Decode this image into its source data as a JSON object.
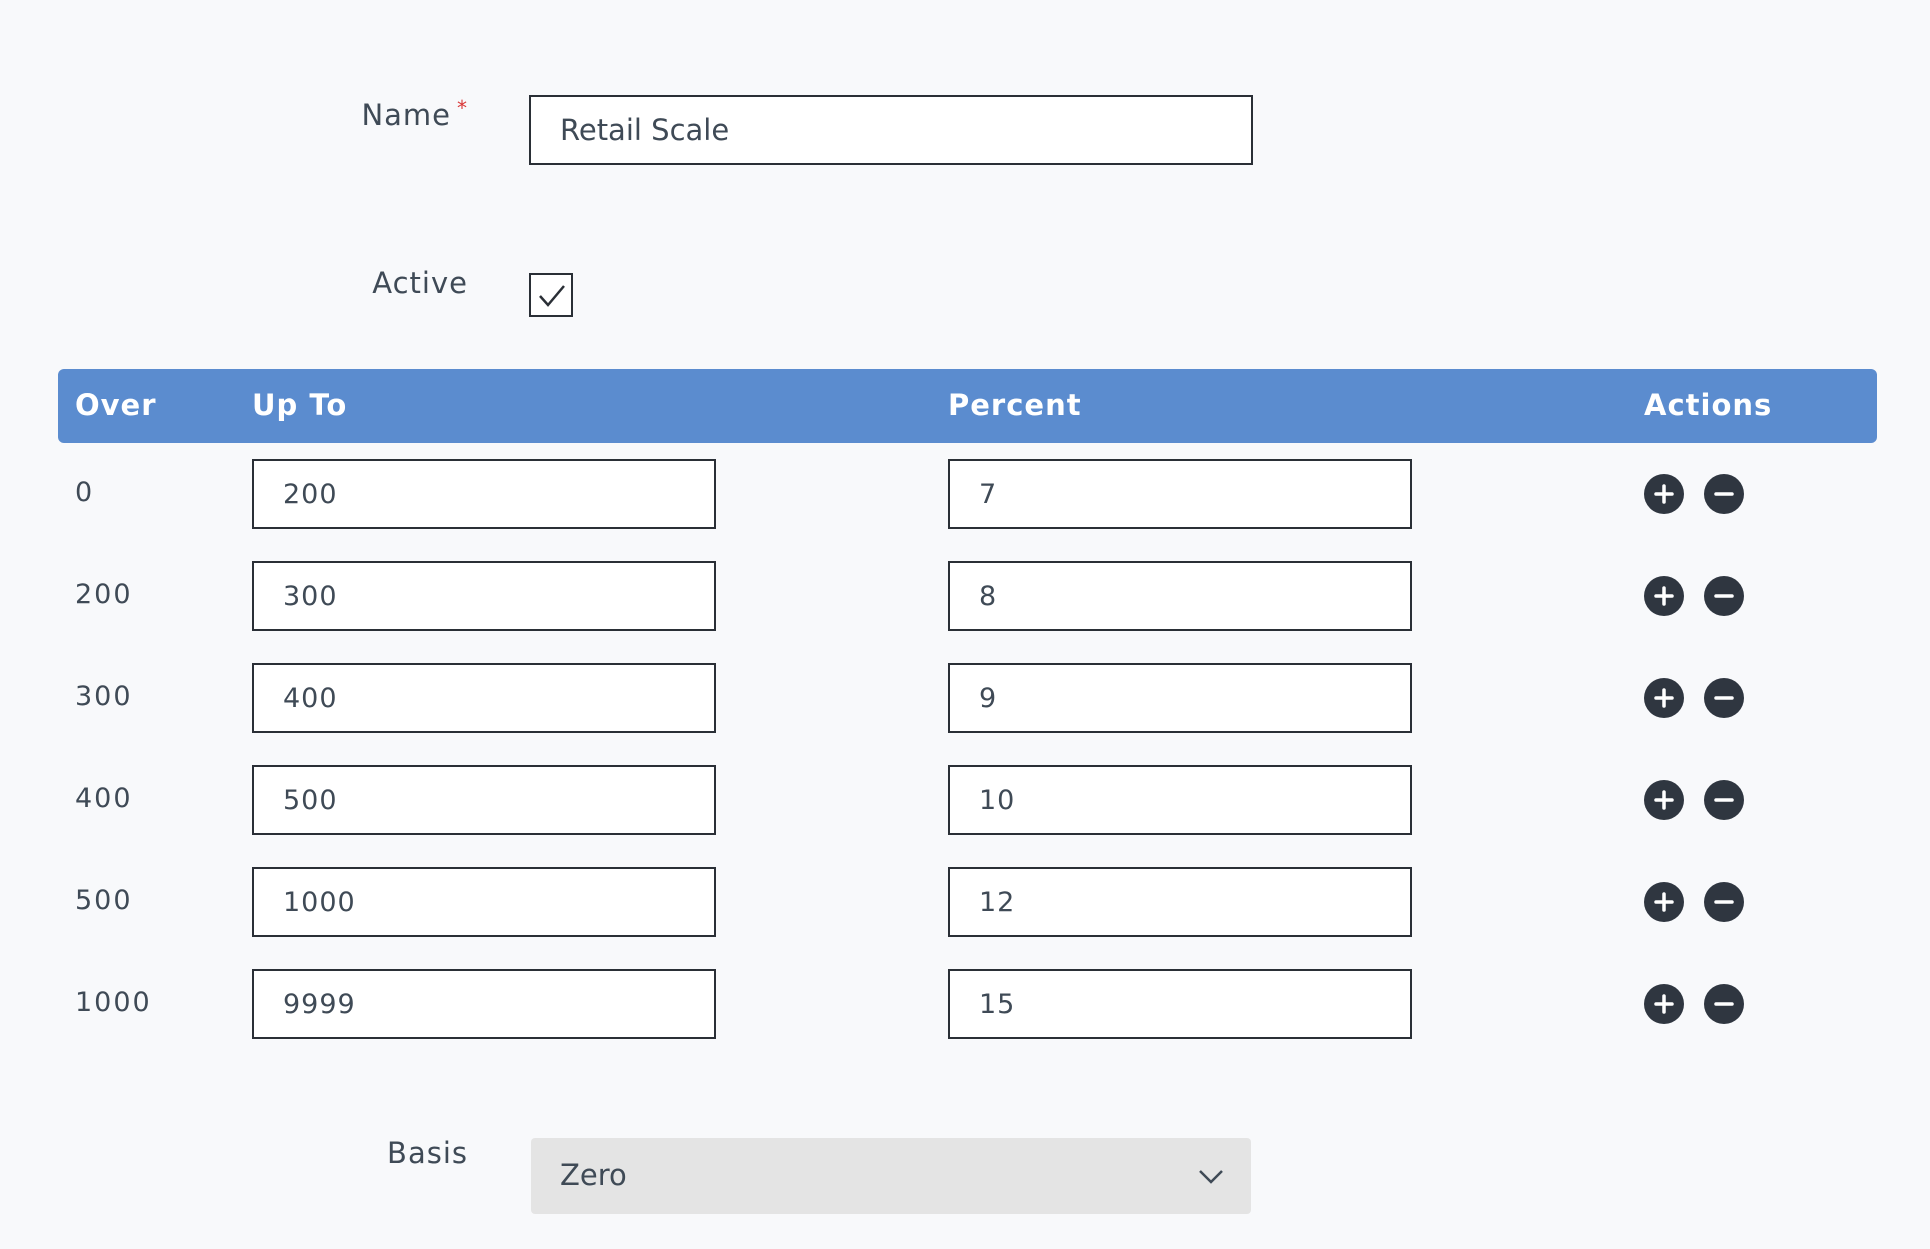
{
  "form": {
    "name_label": "Name",
    "required_marker": "*",
    "name_value": "Retail Scale",
    "active_label": "Active",
    "active_checked": true,
    "basis_label": "Basis",
    "basis_value": "Zero"
  },
  "table": {
    "headers": {
      "over": "Over",
      "up_to": "Up To",
      "percent": "Percent",
      "actions": "Actions"
    },
    "rows": [
      {
        "over": "0",
        "up_to": "200",
        "percent": "7"
      },
      {
        "over": "200",
        "up_to": "300",
        "percent": "8"
      },
      {
        "over": "300",
        "up_to": "400",
        "percent": "9"
      },
      {
        "over": "400",
        "up_to": "500",
        "percent": "10"
      },
      {
        "over": "500",
        "up_to": "1000",
        "percent": "12"
      },
      {
        "over": "1000",
        "up_to": "9999",
        "percent": "15"
      }
    ]
  },
  "icons": {
    "add": "plus-circle-icon",
    "remove": "minus-circle-icon",
    "checkbox": "check-icon",
    "select": "chevron-down-icon"
  },
  "colors": {
    "header_bg": "#5b8ccf",
    "required": "#d93838",
    "action_icon": "#2f3640"
  }
}
